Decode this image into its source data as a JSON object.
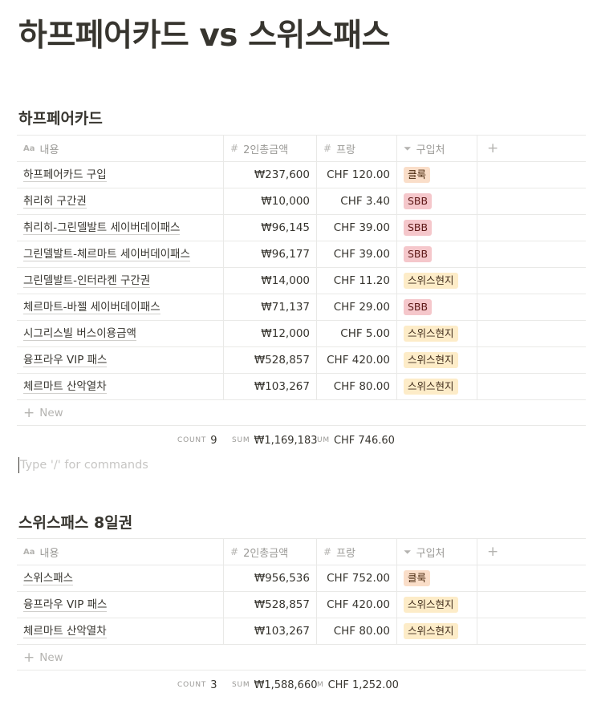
{
  "page": {
    "title": "하프페어카드 vs 스위스패스"
  },
  "columns": {
    "name": "내용",
    "amount": "2인총금액",
    "chf": "프랑",
    "store": "구입처",
    "name_icon": "Aa",
    "number_icon": "#",
    "select_icon": "⏷",
    "add_icon": "+"
  },
  "table1": {
    "title": "하프페어카드",
    "rows": [
      {
        "name": "하프페어카드 구입",
        "amount": "₩237,600",
        "chf": "CHF 120.00",
        "store": "클룩",
        "store_color": "orange"
      },
      {
        "name": "취리히 구간권",
        "amount": "₩10,000",
        "chf": "CHF 3.40",
        "store": "SBB",
        "store_color": "pink"
      },
      {
        "name": "취리히-그린델발트 세이버데이패스",
        "amount": "₩96,145",
        "chf": "CHF 39.00",
        "store": "SBB",
        "store_color": "pink"
      },
      {
        "name": "그린델발트-체르마트 세이버데이패스",
        "amount": "₩96,177",
        "chf": "CHF 39.00",
        "store": "SBB",
        "store_color": "pink"
      },
      {
        "name": "그린델발트-인터라켄 구간권",
        "amount": "₩14,000",
        "chf": "CHF 11.20",
        "store": "스위스현지",
        "store_color": "yellow"
      },
      {
        "name": "체르마트-바젤 세이버데이패스",
        "amount": "₩71,137",
        "chf": "CHF 29.00",
        "store": "SBB",
        "store_color": "pink"
      },
      {
        "name": "시그리스빌 버스이용금액",
        "amount": "₩12,000",
        "chf": "CHF 5.00",
        "store": "스위스현지",
        "store_color": "yellow"
      },
      {
        "name": "융프라우 VIP 패스",
        "amount": "₩528,857",
        "chf": "CHF 420.00",
        "store": "스위스현지",
        "store_color": "yellow"
      },
      {
        "name": "체르마트 산악열차",
        "amount": "₩103,267",
        "chf": "CHF 80.00",
        "store": "스위스현지",
        "store_color": "yellow"
      }
    ],
    "new_label": "New",
    "count_label": "COUNT",
    "count_value": "9",
    "sum_label": "SUM",
    "sum_value": "₩1,169,183",
    "sum2_label": "UM",
    "sum2_value": "CHF 746.60"
  },
  "command_placeholder": "Type '/' for commands",
  "table2": {
    "title": "스위스패스 8일권",
    "rows": [
      {
        "name": "스위스패스",
        "amount": "₩956,536",
        "chf": "CHF 752.00",
        "store": "클룩",
        "store_color": "orange"
      },
      {
        "name": "융프라우 VIP 패스",
        "amount": "₩528,857",
        "chf": "CHF 420.00",
        "store": "스위스현지",
        "store_color": "yellow"
      },
      {
        "name": "체르마트 산악열차",
        "amount": "₩103,267",
        "chf": "CHF 80.00",
        "store": "스위스현지",
        "store_color": "yellow"
      }
    ],
    "new_label": "New",
    "count_label": "COUNT",
    "count_value": "3",
    "sum_label": "SUM",
    "sum_value": "₩1,588,660",
    "sum2_label": "M",
    "sum2_value": "CHF 1,252.00"
  },
  "colors": {
    "orange": "#fadec9",
    "pink": "#f5c7cb",
    "yellow": "#fdecc8",
    "text": "#37352f",
    "muted": "#9b9a97"
  }
}
